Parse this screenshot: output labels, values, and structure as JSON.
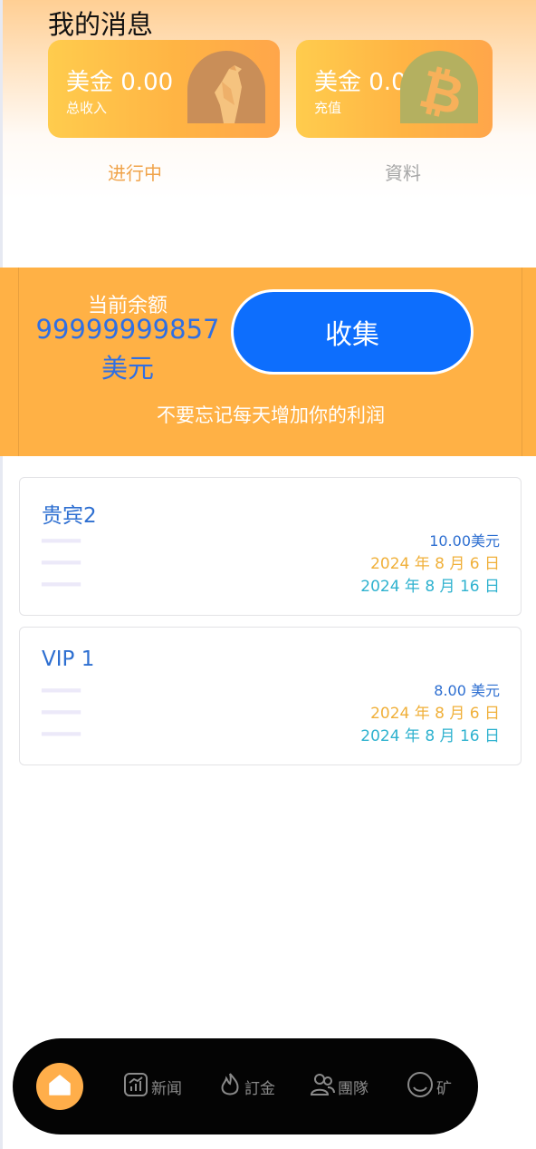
{
  "header": {
    "title": "我的消息"
  },
  "cards": [
    {
      "amount": "美金 0.00",
      "label": "总收入",
      "icon": "bird-icon"
    },
    {
      "amount": "美金 0.00",
      "label": "充值",
      "icon": "bitcoin-icon"
    }
  ],
  "tabs": [
    {
      "label": "进行中",
      "active": true
    },
    {
      "label": "資料",
      "active": false
    }
  ],
  "balance": {
    "label": "当前余额",
    "value": "99999999857",
    "unit": "美元",
    "collect_label": "收集",
    "reminder": "不要忘记每天增加你的利润"
  },
  "plans": [
    {
      "name": "贵宾2",
      "price": "10.00美元",
      "start_date": "2024 年 8 月 6 日",
      "end_date": "2024 年 8 月 16 日"
    },
    {
      "name": "VIP 1",
      "price": "8.00 美元",
      "start_date": "2024 年 8 月 6 日",
      "end_date": "2024 年 8 月 16 日"
    }
  ],
  "nav": {
    "home_icon": "home-icon",
    "items": [
      {
        "label": "新闻",
        "icon": "chart-icon"
      },
      {
        "label": "訂金",
        "icon": "flame-icon"
      },
      {
        "label": "團隊",
        "icon": "users-icon"
      },
      {
        "label": "矿",
        "icon": "smile-icon"
      }
    ]
  },
  "colors": {
    "accent_orange": "#ffb145",
    "primary_blue": "#0d6efd",
    "link_blue": "#2e6fd1",
    "date_orange": "#f0b03a",
    "date_teal": "#2fb2cf"
  }
}
